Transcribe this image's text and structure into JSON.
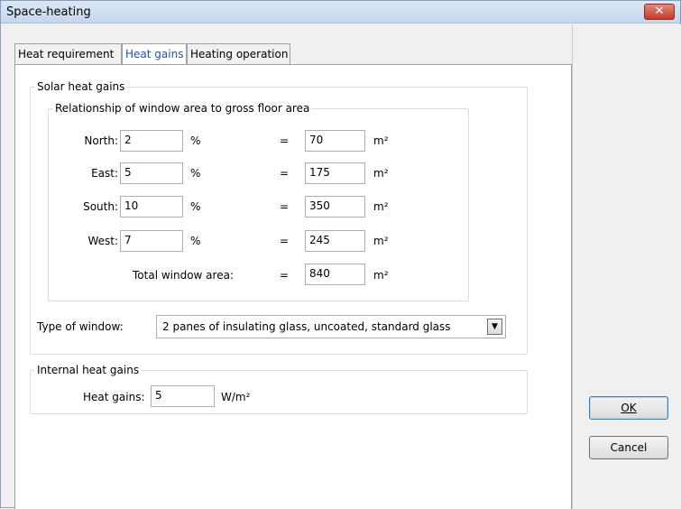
{
  "window": {
    "title": "Space-heating",
    "close_icon": "✕"
  },
  "tabs": [
    {
      "label": "Heat requirement"
    },
    {
      "label": "Heat gains"
    },
    {
      "label": "Heating operation"
    }
  ],
  "solar": {
    "legend": "Solar heat gains",
    "ratio_legend": "Relationship of window area to gross floor area",
    "rows": [
      {
        "label": "North:",
        "percent": "2",
        "percent_unit": "%",
        "eq": "=",
        "area": "70",
        "area_unit": "m²"
      },
      {
        "label": "East:",
        "percent": "5",
        "percent_unit": "%",
        "eq": "=",
        "area": "175",
        "area_unit": "m²"
      },
      {
        "label": "South:",
        "percent": "10",
        "percent_unit": "%",
        "eq": "=",
        "area": "350",
        "area_unit": "m²"
      },
      {
        "label": "West:",
        "percent": "7",
        "percent_unit": "%",
        "eq": "=",
        "area": "245",
        "area_unit": "m²"
      }
    ],
    "total": {
      "label": "Total window area:",
      "eq": "=",
      "value": "840",
      "unit": "m²"
    },
    "window_type": {
      "label": "Type of window:",
      "value": "2 panes of insulating glass, uncoated, standard glass"
    }
  },
  "internal": {
    "legend": "Internal heat gains",
    "label": "Heat gains:",
    "value": "5",
    "unit": "W/m²"
  },
  "buttons": {
    "ok": "OK",
    "cancel": "Cancel"
  },
  "colors": {
    "active_tab_text": "#1b55a8",
    "close_button": "#c23b2a"
  }
}
